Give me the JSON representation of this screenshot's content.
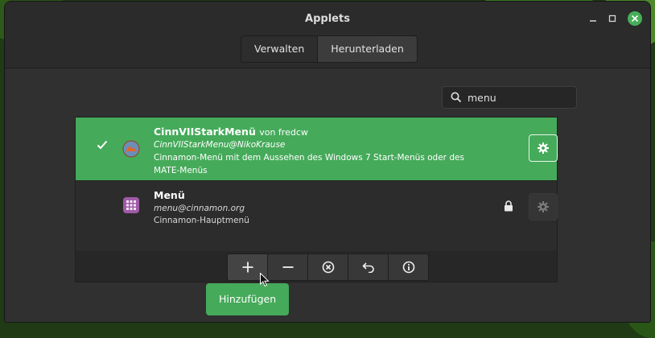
{
  "window": {
    "title": "Applets",
    "controls": [
      "minimize-icon",
      "maximize-icon",
      "close-icon"
    ]
  },
  "tabs": [
    {
      "label": "Verwalten",
      "active": false
    },
    {
      "label": "Herunterladen",
      "active": true
    }
  ],
  "search": {
    "value": "menu",
    "icon": "search-icon"
  },
  "applets": [
    {
      "name": "CinnVIIStarkMenü",
      "author": "von fredcw",
      "uuid": "CinnVIIStarkMenu@NikoKrause",
      "description": "Cinnamon-Menü mit dem Aussehen des Windows 7 Start-Menüs oder des MATE-Menüs",
      "installed": true,
      "selected": true
    },
    {
      "name": "Menü",
      "author": "",
      "uuid": "menu@cinnamon.org",
      "description": "Cinnamon-Hauptmenü",
      "installed": false,
      "locked": true,
      "selected": false
    }
  ],
  "toolbar": {
    "buttons": [
      "add-icon",
      "remove-icon",
      "uninstall-icon",
      "restore-icon",
      "about-icon"
    ]
  },
  "tooltip": {
    "text": "Hinzufügen"
  },
  "colors": {
    "selection": "#45aa5a",
    "window": "#2b2b2b",
    "content": "#303030"
  }
}
